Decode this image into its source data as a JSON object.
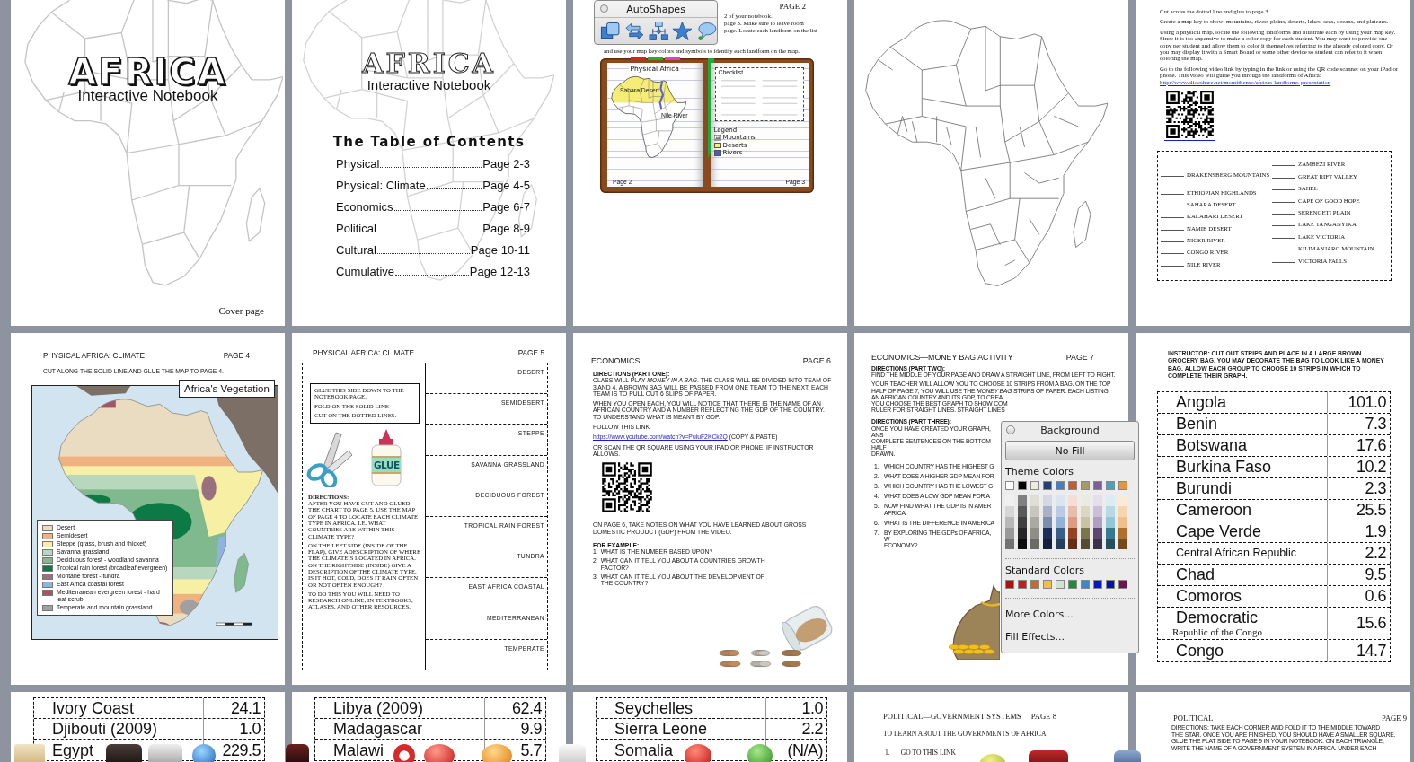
{
  "slides": [
    {
      "kind": "cover",
      "title": "AFRICA",
      "subtitle": "Interactive Notebook",
      "caption": "Cover page"
    },
    {
      "kind": "contents",
      "title": "AFRICA",
      "subtitle": "Interactive Notebook",
      "heading": "The Table of Contents",
      "entries": [
        {
          "topic": "Physical",
          "page": "Page 2-3"
        },
        {
          "topic": "Physical: Climate",
          "page": "Page 4-5"
        },
        {
          "topic": "Economics",
          "page": "Page 6-7"
        },
        {
          "topic": "Political",
          "page": "Page 8-9"
        },
        {
          "topic": "Cultural",
          "page": "Page 10-11"
        },
        {
          "topic": "Cumulative",
          "page": "Page 12-13"
        }
      ]
    },
    {
      "kind": "landform_book",
      "page": "PAGE 2",
      "instruction_lines": [
        "2 of your notebook.",
        "page 3. Make sure to leave room",
        "page. Locate each landform on the list",
        "and use your map key colors and symbols to identify each landform on the map."
      ],
      "book": {
        "title": "Physical Africa",
        "desert_label": "Sahara Desert",
        "river_label": "Nile River",
        "left_page": "Page 2",
        "checklist": "Checklist",
        "legend_title": "Legend",
        "legend": [
          {
            "kind": "mountains",
            "label": "Mountains"
          },
          {
            "kind": "deserts",
            "label": "Deserts"
          },
          {
            "kind": "rivers",
            "label": "Rivers"
          }
        ],
        "right_page": "Page 3"
      }
    },
    {
      "kind": "blank_map"
    },
    {
      "kind": "landform_list",
      "paragraphs": [
        "Cut across the dotted line and glue to page 3.",
        "Create a map key to show: mountains, rivers plains, deserts, lakes, seas, oceans, and plateaus.",
        "Using a physical map, locate the following landforms and illustrate each by using your map key. Since it is too expensive to make a color copy for each student. You may want to provide one copy per student and allow them to color it themselves referring to the already colored copy. Or you may display it with a Smart Board or some other device so student can refer to it when coloring the map.",
        "Go to the following video link by typing in the link or using the QR code scanner on your iPad or phone. This video will guide you through the landforms of Africa:"
      ],
      "link": "http://www.slideshare.net/montithenso/africas-landforms-presentation",
      "left_column": [
        "DRAKENSBERG MOUNTAINS",
        "ETHIOPIAN HIGHLANDS",
        "SAHARA DESERT",
        "KALAHARI DESERT",
        "NAMIB DESERT",
        "NIGER RIVER",
        "CONGO RIVER",
        "NILE RIVER"
      ],
      "right_column": [
        "ZAMBEZI RIVER",
        "GREAT RIFT VALLEY",
        "SAHEL",
        "CAPE OF GOOD HOPE",
        "SERENGETI PLAIN",
        "LAKE TANGANYIKA",
        "LAKE VICTORIA",
        "KILIMANJARO MOUNTAIN",
        "VICTORIA FALLS"
      ]
    },
    {
      "kind": "climate_map",
      "title": "PHYSICAL AFRICA: CLIMATE",
      "page": "PAGE 4",
      "instruction": "CUT ALONG THE SOLID LINE AND GLUE THE MAP TO PAGE 4.",
      "map_title": "Africa's Vegetation",
      "legend": [
        {
          "label": "Desert",
          "color": "#e9dcc0"
        },
        {
          "label": "Semidesert",
          "color": "#f0b27e"
        },
        {
          "label": "Steppe (grass, brush and thicket)",
          "color": "#f7f0a4"
        },
        {
          "label": "Savanna grassland",
          "color": "#b7d8bd"
        },
        {
          "label": "Deciduous forest - woodland savanna",
          "color": "#80b98e"
        },
        {
          "label": "Tropical rain forest (broadleaf evergreen)",
          "color": "#0d7a45"
        },
        {
          "label": "Montane forest - tundra",
          "color": "#98707e"
        },
        {
          "label": "East Africa coastal forest",
          "color": "#8db4dc"
        },
        {
          "label": "Mediterranean evergreen forest - hard leaf scrub",
          "color": "#a45565"
        },
        {
          "label": "Temperate and mountain grassland",
          "color": "#a0a0a0"
        }
      ]
    },
    {
      "kind": "climate_chart",
      "title": "PHYSICAL AFRICA: CLIMATE",
      "page": "PAGE 5",
      "note": [
        "GLUE THIS SIDE DOWN TO THE NOTEBOOK PAGE.",
        "FOLD ON THE SOLID LINE",
        "CUT ON THE DOTTED LINES."
      ],
      "glue_label": "GLUE",
      "directions_heading": "DIRECTIONS:",
      "directions": [
        "AFTER YOU HAVE CUT AND GLUED THE CHART TO PAGE 5, USE THE MAP OF PAGE 4 TO LOCATE EACH CLIMATE TYPE IN AFRICA. I.E. WHAT COUNTRIES ARE WITHIN THIS CLIMATE TYPE?",
        "ON THE LEFT SIDE (INSIDE OF THE FLAP), GIVE ADESCRIPTION OF WHERE THE CLIMATEIS LOCATED IN AFRICA. ON THE RIGHTSIDE (INSIDE) GIVE A DESCRIPTION OF THE CLIMATE TYPE. IS IT HOT, COLD, DOES IT RAIN OFTEN OR NOT OFTEN ENOUGH?",
        "TO DO THIS YOU WILL NEED TO RESEARCH ONLINE, IN TEXTBOOKS, ATLASES, AND OTHER RESOURCES."
      ],
      "climates": [
        "DESERT",
        "SEMIDESERT",
        "STEPPE",
        "SAVANNA GRASSLAND",
        "DECIDUOUS FOREST",
        "TROPICAL RAIN FOREST",
        "TUNDRA",
        "EAST AFRICA COASTAL",
        "MEDITERRANEAN",
        "TEMPERATE"
      ]
    },
    {
      "kind": "economics",
      "title": "ECONOMICS",
      "page": "PAGE 6",
      "heading": "DIRECTIONS (PART ONE):",
      "paragraphs": [
        "CLASS WILL PLAY *MONEY IN A BAG*. THE CLASS WILL BE DIVIDED INTO TEAM OF 3 AND 4.  A BROWN BAG WILL BE PASSED FROM ONE TEAM TO THE NEXT. EACH TEAM IS TO PULL OUT 6 SLIPS OF PAPER.",
        "WHEN YOU OPEN EACH, YOU WILL NOTICE THAT THERE IS THE NAME OF AN AFRICAN COUNTRY AND A NUMBER REFLECTING THE GDP OF THE COUNTRY.  TO UNDERSTAND WHAT IS MEANT BY GDP."
      ],
      "link_intro": "FOLLOW THIS LINK",
      "link": "https://www.youtube.com/watch?v=PuiuF2KCk2Q",
      "link_note": "(COPY & PASTE)",
      "scan_note": "OR SCAN THE QR SQUARE USING YOUR IPAD OR PHONE, IF INSTRUCTOR ALLOWS.",
      "notes": "ON PAGE 6, TAKE NOTES ON WHAT YOU HAVE LEARNED ABOUT GROSS DOMESTIC PRODUCT (GDP) FROM THE VIDEO.",
      "example_heading": "FOR EXAMPLE:",
      "examples": [
        {
          "number": "1.",
          "text": "WHAT IS THE NUMBER BASED UPON?"
        },
        {
          "number": "2.",
          "text": "WHAT CAN IT TELL YOU ABOUT A COUNTRIES GROWTH FACTOR?"
        },
        {
          "number": "3.",
          "text": "WHAT CAN IT TELL YOU ABOUT THE DEVELOPMENT OF THE COUNTRY?"
        }
      ]
    },
    {
      "kind": "money_bag",
      "title": "ECONOMICS—MONEY BAG ACTIVITY",
      "page": "PAGE 7",
      "heading": "DIRECTIONS (PART TWO):",
      "paragraph": "FIND THE MIDDLE OF YOUR PAGE AND DRAW A STRAIGHT LINE, FROM LEFT TO RIGHT.",
      "lines": [
        "YOUR TEACHER WILL ALLOW YOU TO CHOOSE 10 STRIPS FROM A BAG. ON THE TOP",
        "HALF OF PAGE 7, YOU WILL USE THE *MONEY BAG* STRIPS OF PAPER. EACH LISTING",
        "AN AFRICAN COUNTRY AND ITS GDP, TO CREA",
        "YOU CHOOSE THE BEST GRAPH TO SHOW COM",
        "RULER FOR STRAIGHT LINES. STRAIGHT LINES"
      ],
      "heading_2": "DIRECTIONS (PART THREE):",
      "lines_2": [
        "ONCE YOU HAVE CREATED YOUR GRAPH, ANS",
        "COMPLETE SENTENCES ON THE BOTTOM HALF",
        "DRAWN."
      ],
      "questions": [
        {
          "number": "1.",
          "lines": [
            "WHICH COUNTRY HAS THE HIGHEST G"
          ]
        },
        {
          "number": "2.",
          "lines": [
            "WHAT DOES A HIGHER GDP MEAN FOR"
          ]
        },
        {
          "number": "3.",
          "lines": [
            "WHICH COUNTRY HAS THE LOWEST G"
          ]
        },
        {
          "number": "4.",
          "lines": [
            "WHAT DOES A LOW GDP MEAN FOR A"
          ]
        },
        {
          "number": "5.",
          "lines": [
            "NOW FIND WHAT THE GDP IS IN AMER",
            "AFRICA."
          ]
        },
        {
          "number": "6.",
          "lines": [
            "WHAT IS THE DIFFERENCE IN AMERICA"
          ]
        },
        {
          "number": "7.",
          "lines": [
            "BY EXPLORING THE GDPs OF AFRICA, W",
            "ECONOMY?"
          ]
        }
      ]
    },
    {
      "kind": "gdp_strips",
      "note": "INSTRUCTOR: CUT OUT STRIPS AND PLACE IN A LARGE BROWN GROCERY BAG. YOU MAY DECORATE THE BAG TO LOOK LIKE A MONEY BAG. ALLOW EACH GROUP TO CHOOSE 10 STRIPS IN WHICH TO COMPLETE THEIR GRAPH.",
      "strips": [
        {
          "country": "Angola",
          "gdp": "101.0"
        },
        {
          "country": "Benin",
          "gdp": "7.3"
        },
        {
          "country": "Botswana",
          "gdp": "17.6"
        },
        {
          "country": "Burkina Faso",
          "gdp": "10.2"
        },
        {
          "country": "Burundi",
          "gdp": "2.3"
        },
        {
          "country": "Cameroon",
          "gdp": "25.5"
        },
        {
          "country": "Cape Verde",
          "gdp": "1.9"
        },
        {
          "country": "Central African Republic",
          "gdp": "2.2"
        },
        {
          "country": "Chad",
          "gdp": "9.5"
        },
        {
          "country": "Comoros",
          "gdp": "0.6"
        },
        {
          "country": "Democratic",
          "country_line_2": "Republic of the Congo",
          "gdp": "15.6"
        },
        {
          "country": "Congo",
          "gdp": "14.7"
        }
      ]
    },
    {
      "kind": "gdp_strips",
      "strips": [
        {
          "country": "Ivory Coast",
          "gdp": "24.1"
        },
        {
          "country": "Djibouti (2009)",
          "gdp": "1.0"
        },
        {
          "country": "Egypt",
          "gdp": "229.5"
        }
      ]
    },
    {
      "kind": "gdp_strips",
      "strips": [
        {
          "country": "Libya (2009)",
          "gdp": "62.4"
        },
        {
          "country": "Madagascar",
          "gdp": "9.9"
        },
        {
          "country": "Malawi",
          "gdp": "5.7"
        }
      ]
    },
    {
      "kind": "gdp_strips",
      "strips": [
        {
          "country": "Seychelles",
          "gdp": "1.0"
        },
        {
          "country": "Sierra Leone",
          "gdp": "2.2"
        },
        {
          "country": "Somalia",
          "gdp": "(N/A)"
        }
      ]
    },
    {
      "kind": "government_systems",
      "title": "POLITICAL—GOVERNMENT SYSTEMS",
      "page": "PAGE 8",
      "intro": "TO LEARN ABOUT THE GOVERNMENTS OF AFRICA,",
      "steps": [
        {
          "number": "1.",
          "text": "GO TO THIS LINK"
        }
      ]
    },
    {
      "kind": "political",
      "title": "POLITICAL",
      "page": "PAGE 9",
      "direction_lines": [
        "DIRECTIONS: TAKE EACH CORNER AND FOLD IT TO THE MIDDLE TOWARD",
        "THE STAR. ONCE YOU ARE FINISHED, YOU SHOULD HAVE A SMALLER SQUARE.",
        "GLUE THE FLAT SIDE TO PAGE 9 IN YOUR NOTEBOOK. ON EACH TRIANGLE,",
        "WRITE THE NAME OF A GOVERNMENT SYSTEM IN AFRICA. UNDER EACH"
      ]
    }
  ],
  "autoshapes_palette": {
    "title": "AutoShapes",
    "tools": [
      {
        "kind": "shapes"
      },
      {
        "kind": "arrows"
      },
      {
        "kind": "flowchart"
      },
      {
        "kind": "stars"
      },
      {
        "kind": "callouts"
      }
    ]
  },
  "background_popup": {
    "title": "Background",
    "no_fill": "No Fill",
    "theme_label": "Theme Colors",
    "theme_colors": [
      {
        "color": "#ffffff"
      },
      {
        "color": "#000000"
      },
      {
        "color": "#eeece1"
      },
      {
        "color": "#243f78"
      },
      {
        "color": "#4a7ebb"
      },
      {
        "color": "#c9592f"
      },
      {
        "color": "#a59b66"
      },
      {
        "color": "#7a5f99"
      },
      {
        "color": "#4aa0c0"
      },
      {
        "color": "#e8953a"
      }
    ],
    "standard_label": "Standard Colors",
    "standard_colors": [
      {
        "color": "#b01010"
      },
      {
        "color": "#d01818"
      },
      {
        "color": "#d2642e"
      },
      {
        "color": "#f2c040"
      },
      {
        "color": "#cfe3d2"
      },
      {
        "color": "#1c8c3a"
      },
      {
        "color": "#3c88c0"
      },
      {
        "color": "#0a14c8"
      },
      {
        "color": "#0a10b0"
      },
      {
        "color": "#6e1450"
      }
    ],
    "more_colors": "More Colors...",
    "fill_effects": "Fill Effects..."
  }
}
